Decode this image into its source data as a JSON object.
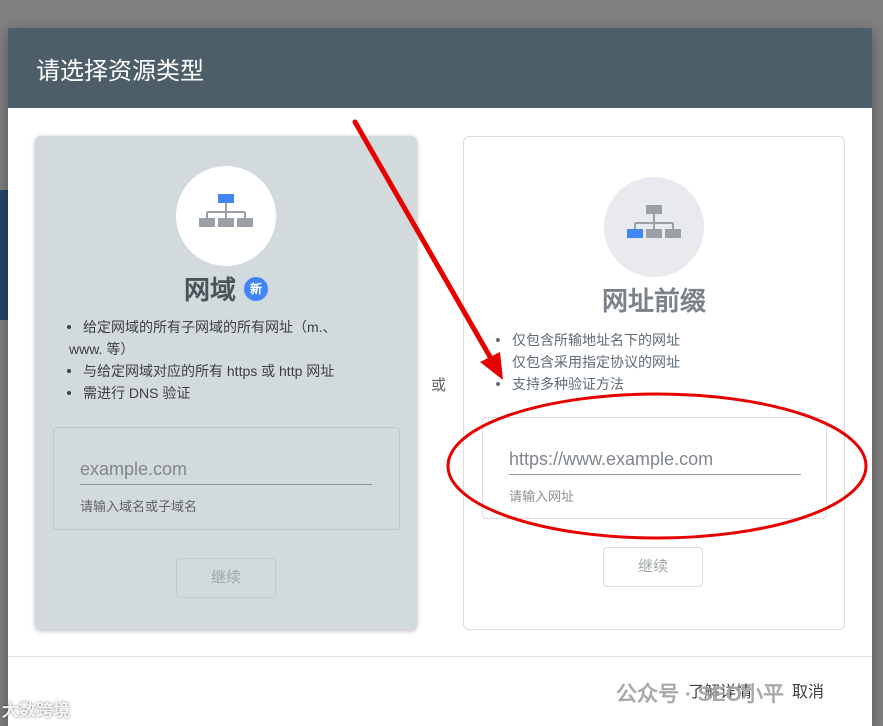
{
  "dialog": {
    "title": "请选择资源类型",
    "or_label": "或",
    "learn_more": "了解详情",
    "cancel": "取消"
  },
  "domain_card": {
    "icon": "sitemap-icon",
    "title": "网域",
    "badge": "新",
    "bullets": [
      "给定网域的所有子网域的所有网址（m.、",
      "www. 等）",
      "与给定网域对应的所有 https 或 http 网址",
      "需进行 DNS 验证"
    ],
    "input_placeholder": "example.com",
    "input_hint": "请输入域名或子域名",
    "continue": "继续"
  },
  "prefix_card": {
    "icon": "sitemap-icon",
    "title": "网址前缀",
    "bullets": [
      "仅包含所输地址名下的网址",
      "仅包含采用指定协议的网址",
      "支持多种验证方法"
    ],
    "input_placeholder": "https://www.example.com",
    "input_hint": "请输入网址",
    "continue": "继续"
  },
  "colors": {
    "header": "#4d5e68",
    "domain_card_bg": "#d2dade",
    "accent_blue": "#4285f4",
    "annotation_red": "#e60000"
  },
  "watermarks": {
    "right": "公众号 · SEO小平",
    "left": "大数跨境"
  }
}
